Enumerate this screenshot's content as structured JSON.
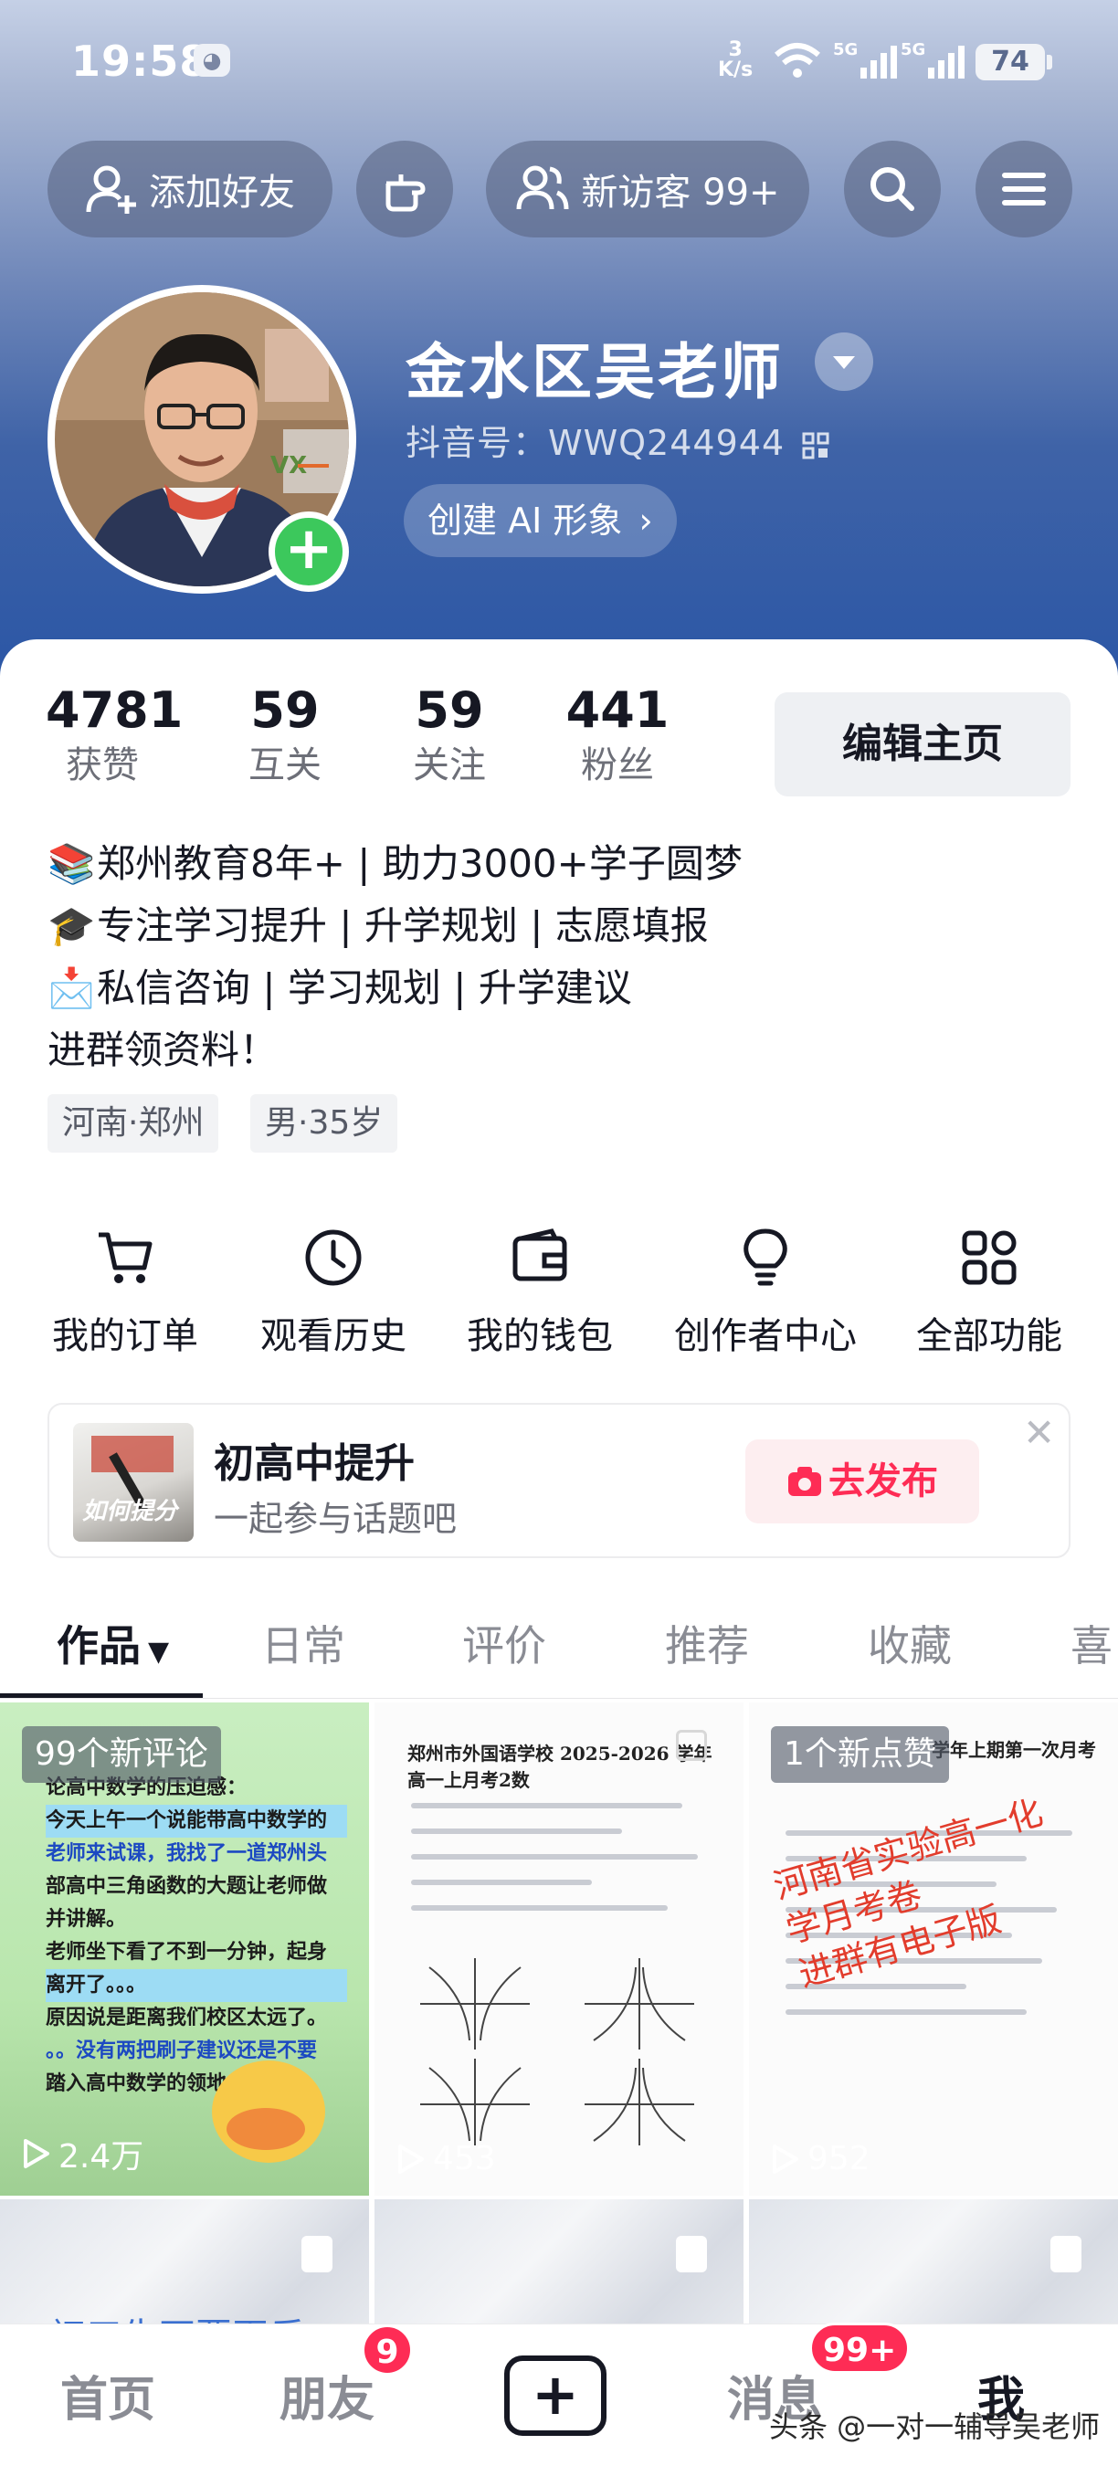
{
  "status_bar": {
    "time": "19:58",
    "speed_value": "3",
    "speed_unit": "K/s",
    "network_1": "5G",
    "network_2": "5G",
    "battery": "74"
  },
  "header": {
    "add_friend": "添加好友",
    "visitors": "新访客 99+"
  },
  "profile": {
    "name": "金水区吴老师",
    "douyin_id": "抖音号：WWQ244944",
    "ai_image": "创建 AI 形象",
    "avatar_text": "VX"
  },
  "stats": [
    {
      "value": "4781",
      "label": "获赞"
    },
    {
      "value": "59",
      "label": "互关"
    },
    {
      "value": "59",
      "label": "关注"
    },
    {
      "value": "441",
      "label": "粉丝"
    }
  ],
  "edit_profile": "编辑主页",
  "bio": [
    "郑州教育8年+ | 助力3000+学子圆梦",
    "专注学习提升 | 升学规划 | 志愿填报",
    "私信咨询 | 学习规划 | 升学建议",
    "进群领资料！"
  ],
  "tags": [
    "河南·郑州",
    "男·35岁"
  ],
  "functions": [
    {
      "label": "我的订单",
      "icon": "cart-icon"
    },
    {
      "label": "观看历史",
      "icon": "clock-icon"
    },
    {
      "label": "我的钱包",
      "icon": "wallet-icon"
    },
    {
      "label": "创作者中心",
      "icon": "lightbulb-icon"
    },
    {
      "label": "全部功能",
      "icon": "grid-icon"
    }
  ],
  "topic": {
    "title": "初高中提升",
    "subtitle": "一起参与话题吧",
    "action": "去发布",
    "thumb_text": "如何提分"
  },
  "tabs": [
    "作品",
    "日常",
    "评价",
    "推荐",
    "收藏",
    "喜"
  ],
  "videos": [
    {
      "badge": "99个新评论",
      "views": "2.4万",
      "text": [
        "论高中数学的压迫感：",
        "今天上午一个说能带高中数学的",
        "老师来试课，我找了一道郑州头",
        "部高中三角函数的大题让老师做",
        "并讲解。",
        "老师坐下看了不到一分钟，起身",
        "离开了。。。",
        "原因说是距离我们校区太远了。",
        "。。没有两把刷子建议还是不要",
        "踏入高中数学的领地。"
      ]
    },
    {
      "badge": "",
      "views": "453",
      "doc_title": "郑州市外国语学校 2025-2026 学年高一上月考2数"
    },
    {
      "badge": "1个新点赞",
      "views": "952",
      "doc_title": "学年上期第一次月考",
      "overlay": [
        "河南省实验高一化",
        "学月考卷",
        "进群有电子版"
      ]
    }
  ],
  "partial_text": "初三生不要再乐",
  "bottom_nav": {
    "home": "首页",
    "friends": "朋友",
    "friends_badge": "9",
    "messages": "消息",
    "messages_badge": "99+",
    "me": "我"
  },
  "watermark": "头条 @一对一辅导吴老师",
  "colors": {
    "accent": "#fe2c55",
    "green": "#3cc85c",
    "hero_blue": "#2c57a6"
  }
}
